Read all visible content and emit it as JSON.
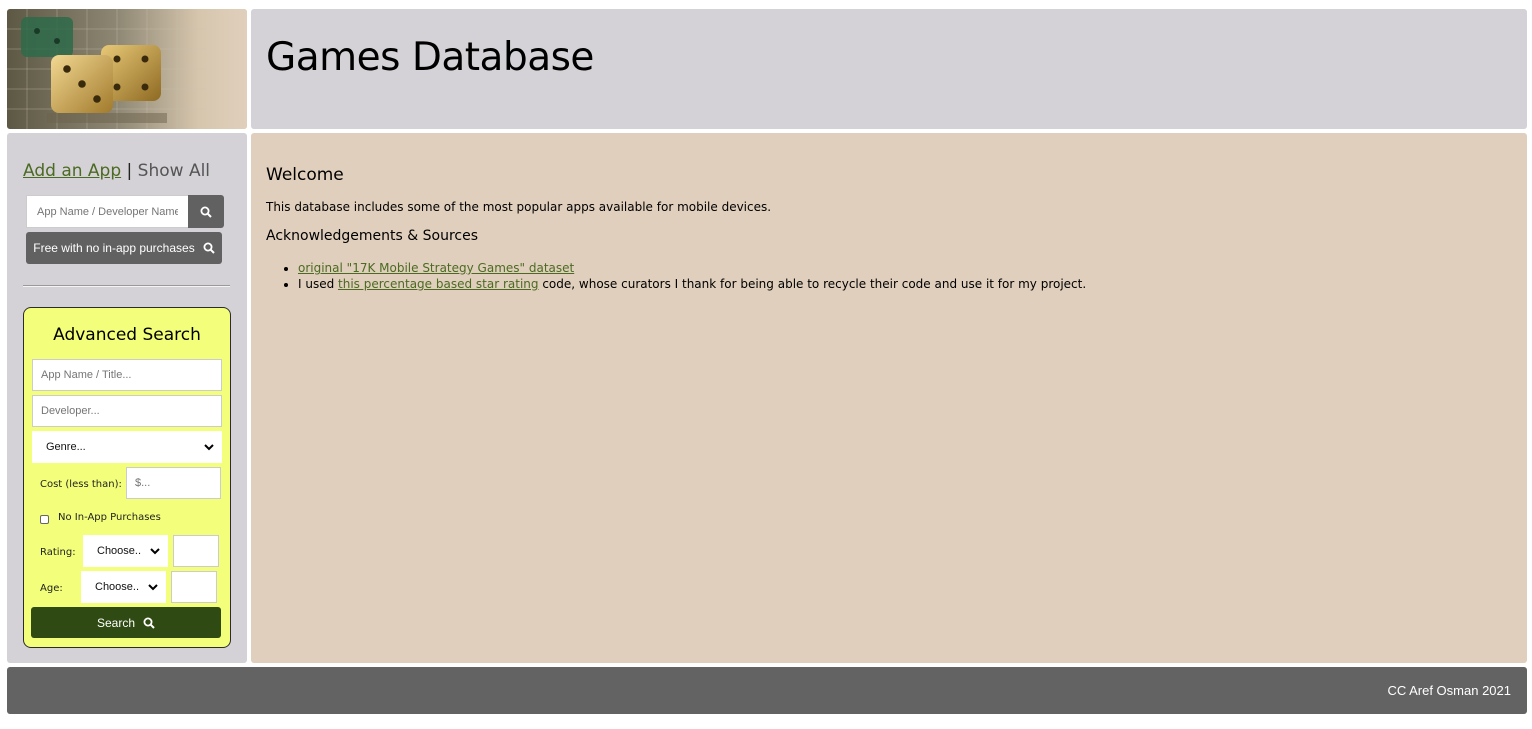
{
  "header": {
    "title": "Games Database"
  },
  "sidebar": {
    "add_app_link": "Add an App",
    "separator": "|",
    "show_all_link": "Show All",
    "quick_search": {
      "placeholder": "App Name / Developer Name"
    },
    "free_button": "Free with no in-app purchases"
  },
  "advanced_search": {
    "title": "Advanced Search",
    "name_placeholder": "App Name / Title...",
    "developer_placeholder": "Developer...",
    "genre_selected": "Genre...",
    "cost_label": "Cost (less than):",
    "cost_placeholder": "$...",
    "no_iap_label": "No In-App Purchases",
    "rating_label": "Rating:",
    "rating_selected": "Choose..",
    "age_label": "Age:",
    "age_selected": "Choose..",
    "search_button": "Search"
  },
  "main": {
    "heading": "Welcome",
    "intro": "This database includes some of the most popular apps available for mobile devices.",
    "ack_heading": "Acknowledgements & Sources",
    "sources": {
      "item1_link": "original \"17K Mobile Strategy Games\" dataset",
      "item2_prefix": "I used ",
      "item2_link": "this percentage based star rating",
      "item2_suffix": " code, whose curators I thank for being able to recycle their code and use it for my project."
    }
  },
  "footer": {
    "text": "CC Aref Osman 2021"
  },
  "colors": {
    "panel_gray": "#d4d2d6",
    "main_tan": "#e0cfbc",
    "footer_gray": "#636363",
    "link_green": "#4b6a22",
    "advanced_yellow": "#f3ff7a",
    "search_button_green": "#2f4a12"
  },
  "icons": [
    "dice-logo-image",
    "search-icon",
    "chevron-down-icon"
  ]
}
